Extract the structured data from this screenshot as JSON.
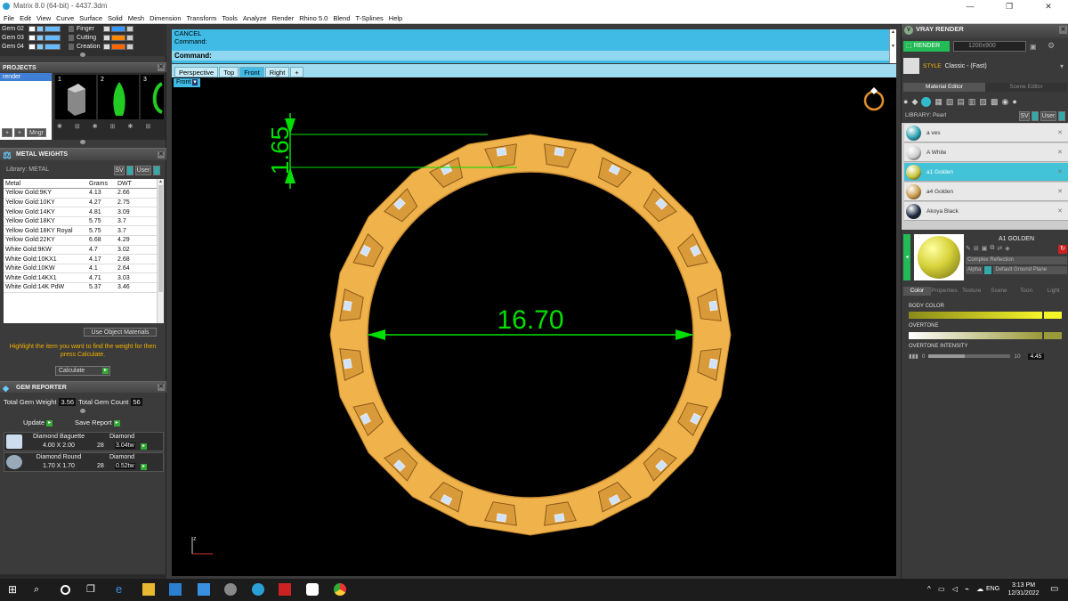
{
  "window": {
    "title": "Matrix 8.0 (64-bit) - 4437.3dm",
    "minimize": "—",
    "maximize": "❐",
    "close": "✕"
  },
  "menu": [
    "File",
    "Edit",
    "View",
    "Curve",
    "Surface",
    "Solid",
    "Mesh",
    "Dimension",
    "Transform",
    "Tools",
    "Analyze",
    "Render",
    "Rhino 5.0",
    "Blend",
    "T-Splines",
    "Help"
  ],
  "layers": {
    "left": [
      {
        "name": "Gem 02"
      },
      {
        "name": "Gem 03"
      },
      {
        "name": "Gem 04"
      }
    ],
    "right": [
      {
        "name": "Finger"
      },
      {
        "name": "Cutting"
      },
      {
        "name": "Creation"
      }
    ]
  },
  "projects": {
    "title": "PROJECTS",
    "tree_item": "render",
    "thumb_nums": [
      "1",
      "2",
      "3"
    ],
    "tool_label": "Mngr"
  },
  "metal_weights": {
    "title": "METAL WEIGHTS",
    "library_label": "Library: METAL",
    "sv": "SV",
    "user": "User",
    "columns": [
      "Metal",
      "Grams",
      "DWT"
    ],
    "rows": [
      [
        "Yellow Gold:9KY",
        "4.13",
        "2.66"
      ],
      [
        "Yellow Gold:10KY",
        "4.27",
        "2.75"
      ],
      [
        "Yellow Gold:14KY",
        "4.81",
        "3.09"
      ],
      [
        "Yellow Gold:18KY",
        "5.75",
        "3.7"
      ],
      [
        "Yellow Gold:18KY Royal",
        "5.75",
        "3.7"
      ],
      [
        "Yellow Gold:22KY",
        "6.68",
        "4.29"
      ],
      [
        "White Gold:9KW",
        "4.7",
        "3.02"
      ],
      [
        "White Gold:10KX1",
        "4.17",
        "2.68"
      ],
      [
        "White Gold:10KW",
        "4.1",
        "2.64"
      ],
      [
        "White Gold:14KX1",
        "4.71",
        "3.03"
      ],
      [
        "White Gold:14K PdW",
        "5.37",
        "3.46"
      ]
    ],
    "use_object_materials": "Use Object Materials",
    "hint": "Highlight the item you want to find the weight for then press Calculate.",
    "calculate": "Calculate"
  },
  "gem_reporter": {
    "title": "GEM REPORTER",
    "total_weight_label": "Total Gem Weight",
    "total_weight": "3.56",
    "total_count_label": "Total Gem Count",
    "total_count": "56",
    "update": "Update",
    "save_report": "Save Report",
    "gems": [
      {
        "cut": "Diamond Baguette",
        "material": "Diamond",
        "size": "4.00 X 2.00",
        "count": "28",
        "weight": "3.04tw"
      },
      {
        "cut": "Diamond Round",
        "material": "Diamond",
        "size": "1.70 X 1.70",
        "count": "28",
        "weight": "0.52tw"
      }
    ]
  },
  "command": {
    "cancel": "CANCEL",
    "command1": "Command:",
    "command2": "Command:"
  },
  "viewport_tabs": [
    "Perspective",
    "Top",
    "Front",
    "Right",
    "+"
  ],
  "viewport_name": "Front",
  "dimensions": {
    "vertical": "1.65",
    "diameter": "16.70"
  },
  "axis_label": "z",
  "vray": {
    "title": "VRAY RENDER",
    "render": "RENDER",
    "resolution": "1200x900",
    "style_label": "STYLE",
    "style_value": "Classic - (Fast)",
    "tabs": [
      "Material Editor",
      "Scene Editor"
    ],
    "library_label": "LIBRARY: Pearl",
    "sv": "SV",
    "user": "User",
    "materials": [
      {
        "name": "a ves",
        "color": "#2a9fb0"
      },
      {
        "name": "A White",
        "color": "#cfcfcf"
      },
      {
        "name": "a1 Golden",
        "color": "#c8c43a"
      },
      {
        "name": "a4 Golden",
        "color": "#c89a4a"
      },
      {
        "name": "Akoya Black",
        "color": "#1c2a40"
      }
    ],
    "selected_name": "A1 GOLDEN",
    "reflection": "Complex Reflection",
    "alpha": "Alpha",
    "ground": "Default Ground Plane",
    "prop_tabs": [
      "Color",
      "Properties",
      "Texture",
      "Scene",
      "Toon",
      "Light"
    ],
    "body_color_label": "BODY COLOR",
    "overtone_label": "OVERTONE",
    "overtone_intensity_label": "OVERTONE INTENSITY",
    "intensity_min": "0",
    "intensity_max": "10",
    "intensity_value": "4.45",
    "intensity_level": 0.445
  },
  "taskbar": {
    "lang": "ENG",
    "time": "3:13 PM",
    "date": "12/31/2022"
  },
  "colors": {
    "ring": "#f0b24a",
    "dim": "#00e000",
    "cyan": "#3fbbe6"
  }
}
